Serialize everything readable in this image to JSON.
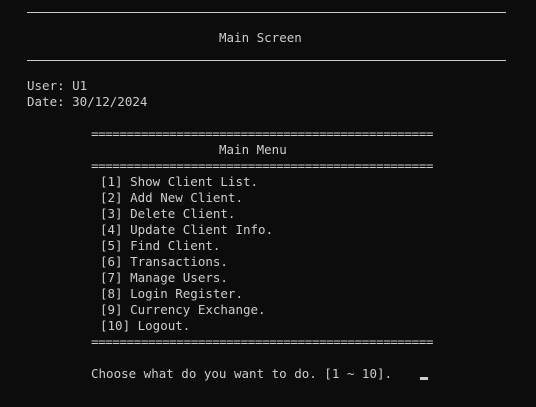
{
  "screen": {
    "title": "Main Screen",
    "user_line": "User: U1",
    "date_line": "Date: 30/12/2024"
  },
  "menu": {
    "separator": "================================================",
    "title": "Main Menu",
    "items": [
      {
        "label": "[1] Show Client List."
      },
      {
        "label": "[2] Add New Client."
      },
      {
        "label": "[3] Delete Client."
      },
      {
        "label": "[4] Update Client Info."
      },
      {
        "label": "[5] Find Client."
      },
      {
        "label": "[6] Transactions."
      },
      {
        "label": "[7] Manage Users."
      },
      {
        "label": "[8] Login Register."
      },
      {
        "label": "[9] Currency Exchange."
      },
      {
        "label": "[10] Logout."
      }
    ]
  },
  "prompt": {
    "text": "Choose what do you want to do. [1 ~ 10]."
  }
}
